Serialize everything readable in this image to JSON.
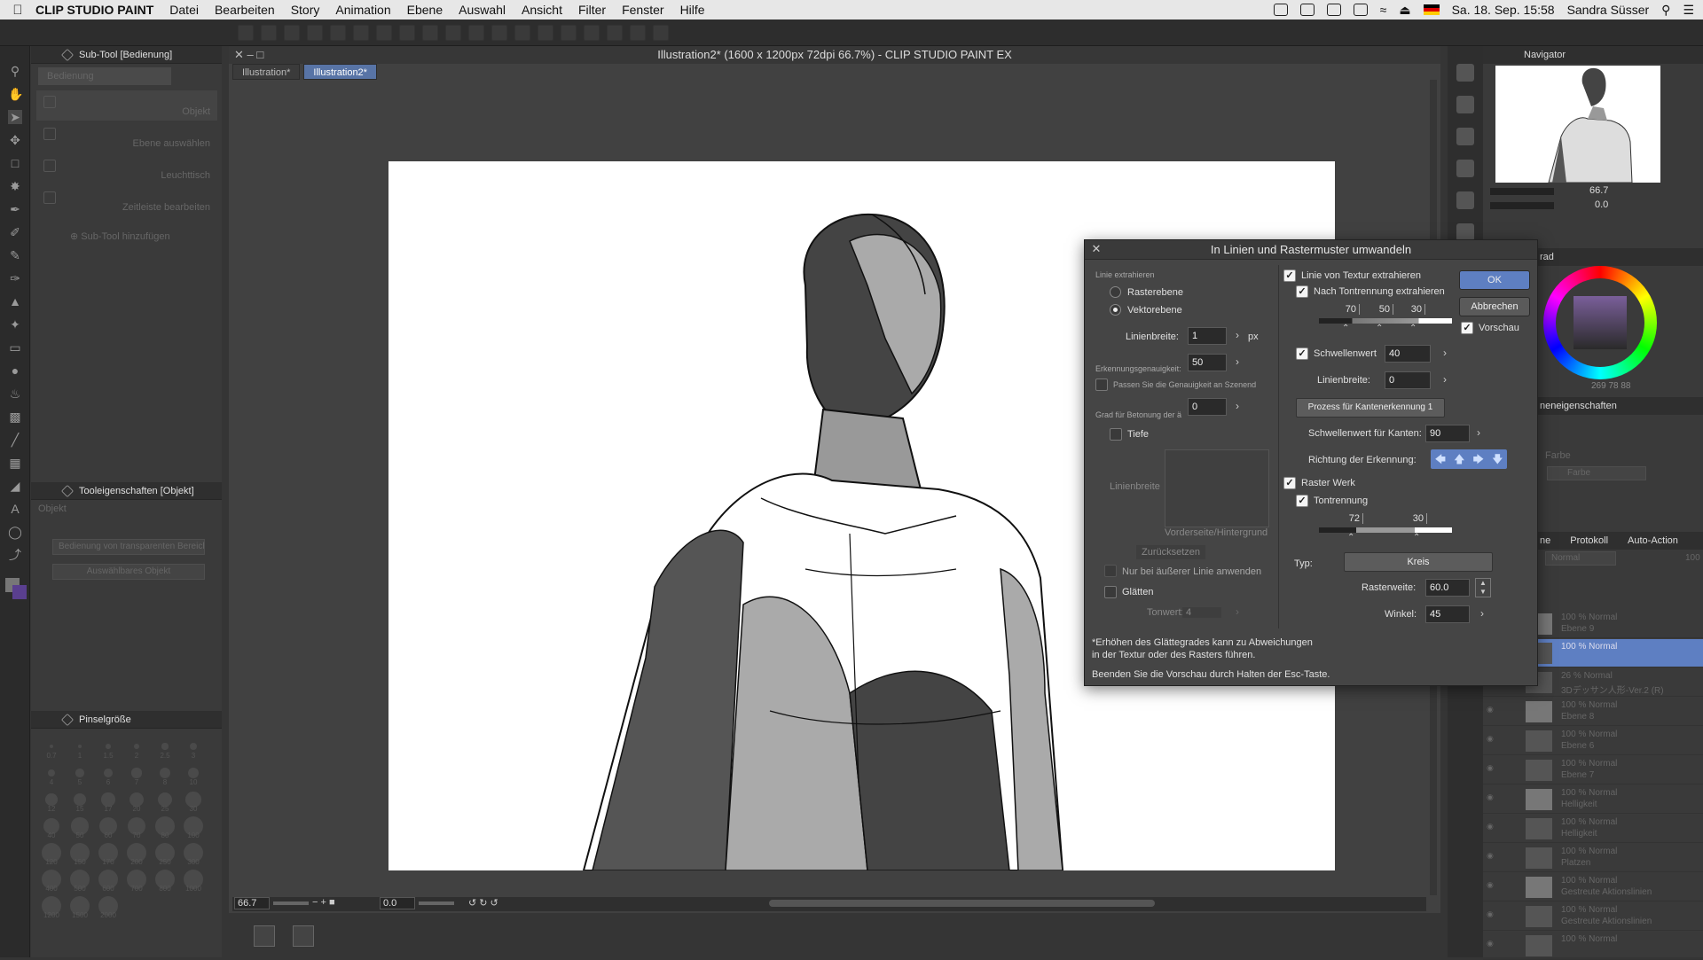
{
  "menubar": {
    "app_name": "CLIP STUDIO PAINT",
    "items": [
      "Datei",
      "Bearbeiten",
      "Story",
      "Animation",
      "Ebene",
      "Auswahl",
      "Ansicht",
      "Filter",
      "Fenster",
      "Hilfe"
    ],
    "clock": "Sa. 18. Sep.  15:58",
    "user": "Sandra Süsser"
  },
  "document": {
    "title": "Illustration2* (1600 x 1200px 72dpi 66.7%)  - CLIP STUDIO PAINT EX",
    "tabs": [
      "Illustration*",
      "Illustration2*"
    ]
  },
  "subtool_panel": {
    "title": "Sub-Tool [Bedienung]",
    "tab": "Bedienung",
    "items": [
      "Objekt",
      "Ebene auswählen",
      "Leuchttisch",
      "Zeitleiste bearbeiten"
    ],
    "add": "Sub-Tool hinzufügen"
  },
  "tool_property": {
    "title": "Tooleigenschaften [Objekt]",
    "label": "Objekt",
    "field1": "Bedienung von transparenten Bereich",
    "field2": "Auswählbares Objekt"
  },
  "brush_size": {
    "title": "Pinselgröße",
    "sizes": [
      "0.7",
      "1",
      "1.5",
      "2",
      "2.5",
      "3",
      "4",
      "5",
      "6",
      "7",
      "8",
      "10",
      "12",
      "15",
      "17",
      "20",
      "25",
      "30",
      "40",
      "50",
      "60",
      "70",
      "80",
      "100",
      "120",
      "150",
      "170",
      "200",
      "250",
      "300",
      "400",
      "500",
      "600",
      "700",
      "800",
      "1000",
      "1200",
      "1500",
      "2000"
    ]
  },
  "status": {
    "zoom": "66.7",
    "rotation": "0.0"
  },
  "navigator": {
    "title": "Navigator",
    "zoom": "66.7",
    "angle": "0.0"
  },
  "color_panel": {
    "values": "269 78 88",
    "tab_partial": "rad"
  },
  "layer_properties": {
    "tab_partial": "neneigenschaften",
    "partial1": "Farbe",
    "partial2": "Farbe"
  },
  "layers_panel": {
    "tabs": [
      "ne",
      "Protokoll",
      "Auto-Action"
    ],
    "blend": "Normal",
    "opacity": "100",
    "layers": [
      {
        "opacity": "100 % Normal",
        "name": "Ebene 9"
      },
      {
        "opacity": "100 % Normal",
        "name": ""
      },
      {
        "opacity": "26 % Normal",
        "name": "3Dデッサン人形-Ver.2 (R)"
      },
      {
        "opacity": "100 % Normal",
        "name": "Ebene 8"
      },
      {
        "opacity": "100 % Normal",
        "name": "Ebene 6"
      },
      {
        "opacity": "100 % Normal",
        "name": "Ebene 7"
      },
      {
        "opacity": "100 % Normal",
        "name": "Helligkeit"
      },
      {
        "opacity": "100 % Normal",
        "name": "Helligkeit"
      },
      {
        "opacity": "100 % Normal",
        "name": "Platzen"
      },
      {
        "opacity": "100 % Normal",
        "name": "Gestreute Aktionslinien"
      },
      {
        "opacity": "100 % Normal",
        "name": "Gestreute Aktionslinien"
      },
      {
        "opacity": "100 % Normal",
        "name": ""
      }
    ]
  },
  "dialog": {
    "title": "In Linien und Rastermuster umwandeln",
    "ok": "OK",
    "cancel": "Abbrechen",
    "preview": "Vorschau",
    "left": {
      "section": "Linie extrahieren",
      "raster_layer": "Rasterebene",
      "vector_layer": "Vektorebene",
      "line_width_label": "Linienbreite:",
      "line_width": "1",
      "unit": "px",
      "accuracy_label": "Erkennungsgenauigkeit:",
      "accuracy": "50",
      "adjust_label": "Passen Sie die Genauigkeit an Szenend",
      "emphasis_label": "Grad für Betonung der ä",
      "emphasis": "0",
      "depth": "Tiefe",
      "linewidth_ph": "Linienbreite",
      "bg_label": "Vorderseite/Hintergrund",
      "reset": "Zurücksetzen",
      "outer_only": "Nur bei äußerer Linie anwenden",
      "smooth": "Glätten",
      "tone_label": "Tonwert:",
      "tone": "4"
    },
    "right": {
      "texture": "Linie von Textur extrahieren",
      "tone_sep": "Nach Tontrennung extrahieren",
      "tone_vals": [
        "70",
        "50",
        "30"
      ],
      "threshold_label": "Schwellenwert",
      "threshold": "40",
      "line_width_label": "Linienbreite:",
      "line_width": "0",
      "edge_process": "Prozess für Kantenerkennung 1",
      "edge_threshold_label": "Schwellenwert für Kanten:",
      "edge_threshold": "90",
      "direction_label": "Richtung der Erkennung:",
      "halftone": "Raster Werk",
      "tone_separation": "Tontrennung",
      "halftone_vals": [
        "72",
        "30"
      ],
      "type_label": "Typ:",
      "type": "Kreis",
      "freq_label": "Rasterweite:",
      "freq": "60.0",
      "angle_label": "Winkel:",
      "angle": "45"
    },
    "note1": "*Erhöhen des Glättegrades kann zu Abweichungen",
    "note2": "in der Textur oder des Rasters führen.",
    "note3": "Beenden Sie die Vorschau durch Halten der Esc-Taste."
  }
}
